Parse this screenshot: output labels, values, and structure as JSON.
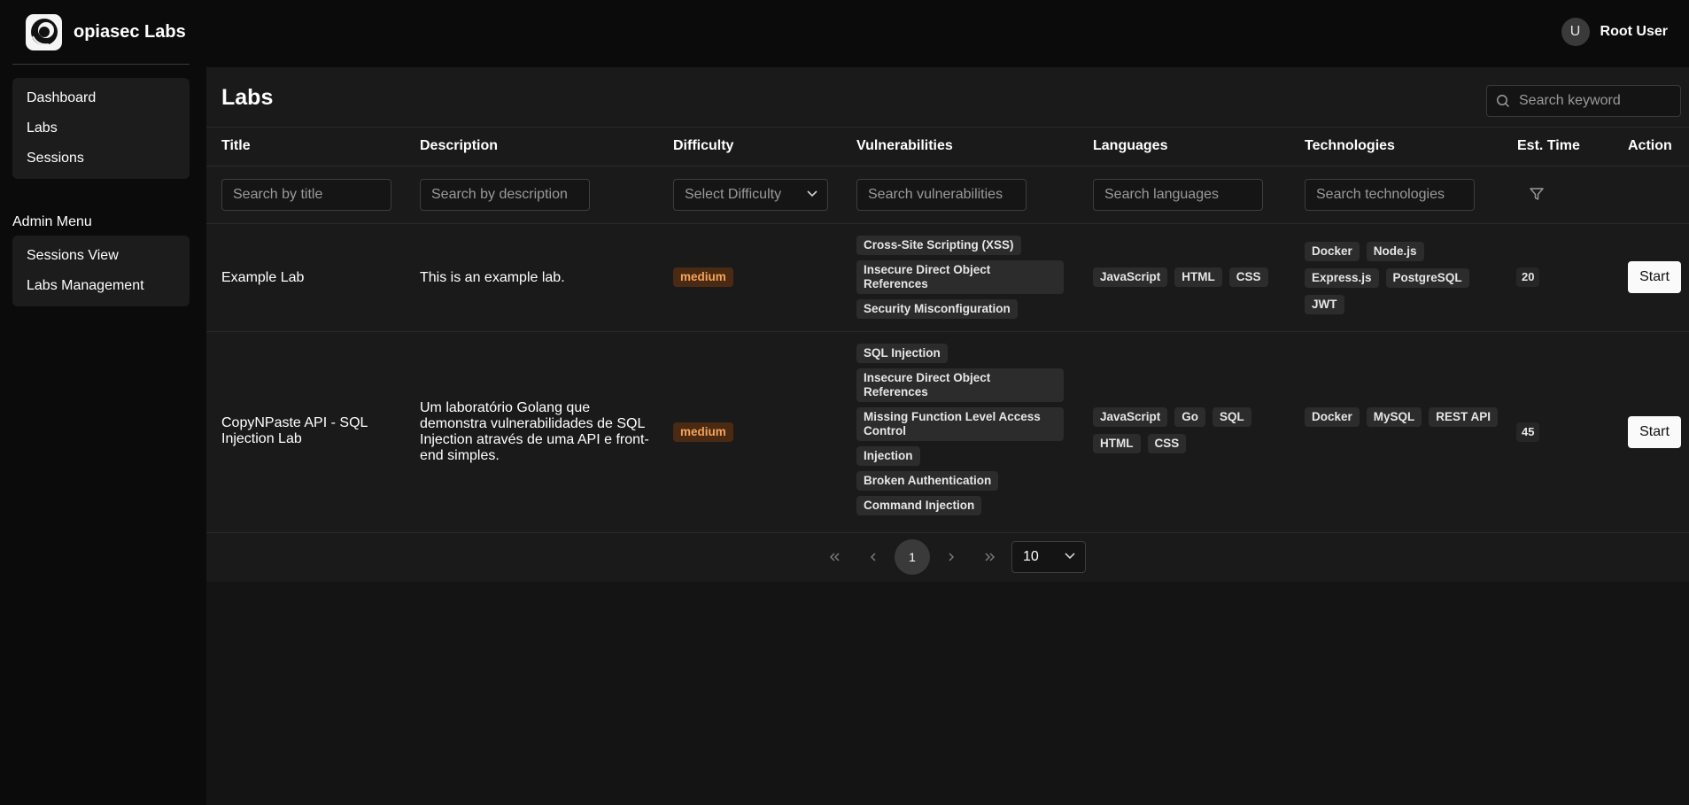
{
  "app": {
    "name": "opiasec Labs"
  },
  "user": {
    "initial": "U",
    "name": "Root User"
  },
  "sidebar": {
    "items": [
      {
        "label": "Dashboard"
      },
      {
        "label": "Labs"
      },
      {
        "label": "Sessions"
      }
    ],
    "admin_title": "Admin Menu",
    "admin_items": [
      {
        "label": "Sessions View"
      },
      {
        "label": "Labs Management"
      }
    ]
  },
  "page": {
    "title": "Labs",
    "search_placeholder": "Search keyword"
  },
  "table": {
    "headers": {
      "title": "Title",
      "description": "Description",
      "difficulty": "Difficulty",
      "vulnerabilities": "Vulnerabilities",
      "languages": "Languages",
      "technologies": "Technologies",
      "est_time": "Est. Time",
      "action": "Action"
    },
    "filters": {
      "title": "Search by title",
      "description": "Search by description",
      "difficulty": "Select Difficulty",
      "vulnerabilities": "Search vulnerabilities",
      "languages": "Search languages",
      "technologies": "Search technologies"
    },
    "rows": [
      {
        "title": "Example Lab",
        "description": "This is an example lab.",
        "difficulty": "medium",
        "vulnerabilities": [
          "Cross-Site Scripting (XSS)",
          "Insecure Direct Object References",
          "Security Misconfiguration"
        ],
        "languages": [
          "JavaScript",
          "HTML",
          "CSS"
        ],
        "technologies": [
          "Docker",
          "Node.js",
          "Express.js",
          "PostgreSQL",
          "JWT"
        ],
        "est_time": "20",
        "action": "Start"
      },
      {
        "title": "CopyNPaste API - SQL Injection Lab",
        "description": "Um laboratório Golang que demonstra vulnerabilidades de SQL Injection através de uma API e front-end simples.",
        "difficulty": "medium",
        "vulnerabilities": [
          "SQL Injection",
          "Insecure Direct Object References",
          "Missing Function Level Access Control",
          "Injection",
          "Broken Authentication",
          "Command Injection"
        ],
        "languages": [
          "JavaScript",
          "Go",
          "SQL",
          "HTML",
          "CSS"
        ],
        "technologies": [
          "Docker",
          "MySQL",
          "REST API"
        ],
        "est_time": "45",
        "action": "Start"
      }
    ]
  },
  "pagination": {
    "current_page": "1",
    "page_size": "10"
  },
  "colors": {
    "difficulty_medium_bg": "#4a2a12",
    "difficulty_medium_text": "#f5a45a"
  }
}
